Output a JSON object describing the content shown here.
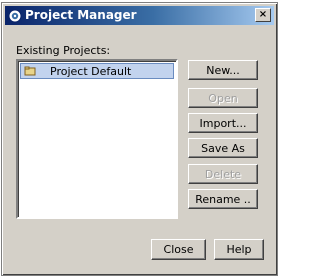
{
  "window": {
    "title": "Project Manager",
    "close_glyph": "×"
  },
  "existing": {
    "label": "Existing Projects:",
    "items": [
      {
        "label": "Project Default",
        "icon": "project-icon",
        "selected": true
      }
    ]
  },
  "side_buttons": {
    "new": {
      "label": "New...",
      "enabled": true
    },
    "open": {
      "label": "Open",
      "enabled": false
    },
    "import": {
      "label": "Import...",
      "enabled": true
    },
    "saveas": {
      "label": "Save As",
      "enabled": true
    },
    "delete": {
      "label": "Delete",
      "enabled": false
    },
    "rename": {
      "label": "Rename ..",
      "enabled": true
    }
  },
  "footer": {
    "close": {
      "label": "Close"
    },
    "help": {
      "label": "Help"
    }
  },
  "colors": {
    "title_start": "#0a246a",
    "title_end": "#a6caf0",
    "face": "#d4d0c8",
    "selection": "#c2d3ee"
  }
}
